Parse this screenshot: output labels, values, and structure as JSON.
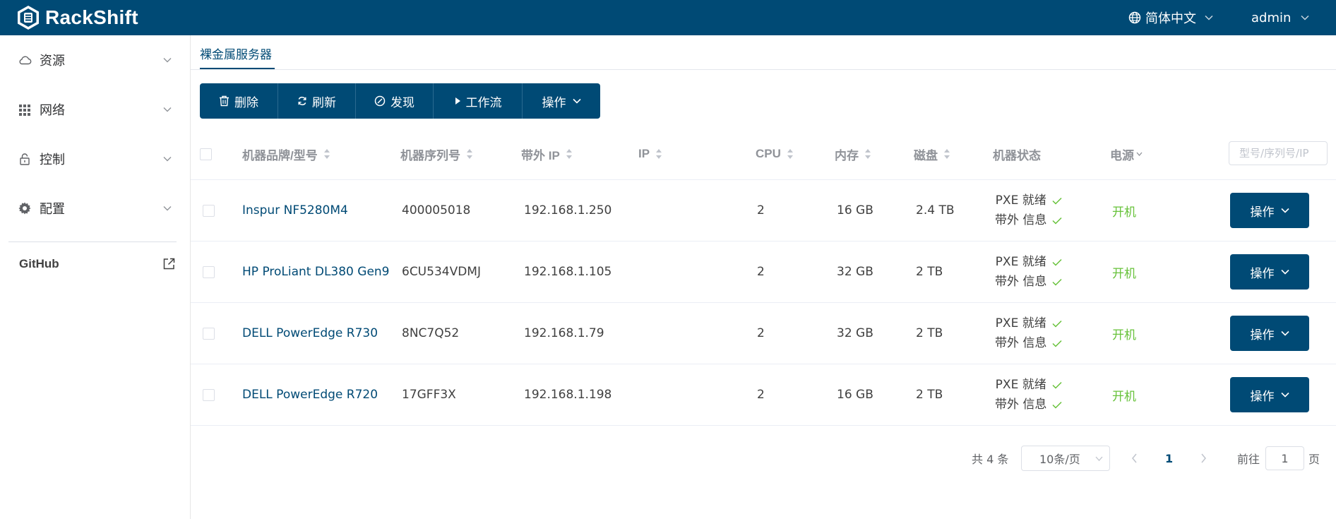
{
  "header": {
    "app_name": "RackShift",
    "language": "简体中文",
    "user": "admin",
    "brand_color": "#004a75"
  },
  "sidebar": {
    "items": [
      {
        "label": "资源",
        "icon": "cloud-icon"
      },
      {
        "label": "网络",
        "icon": "grid-icon"
      },
      {
        "label": "控制",
        "icon": "lock-icon"
      },
      {
        "label": "配置",
        "icon": "gear-icon"
      }
    ],
    "github": "GitHub"
  },
  "tabs": [
    {
      "label": "裸金属服务器",
      "active": true
    }
  ],
  "toolbar": {
    "delete": "删除",
    "refresh": "刷新",
    "discover": "发现",
    "workflow": "工作流",
    "actions": "操作"
  },
  "table": {
    "columns": {
      "model": "机器品牌/型号",
      "serial": "机器序列号",
      "oob_ip": "带外 IP",
      "ip": "IP",
      "cpu": "CPU",
      "memory": "内存",
      "disk": "磁盘",
      "status": "机器状态",
      "power": "电源"
    },
    "search_placeholder": "型号/序列号/IP",
    "rows": [
      {
        "model": "Inspur NF5280M4",
        "serial": "400005018",
        "oob_ip": "192.168.1.250",
        "ip": "",
        "cpu": "2",
        "memory": "16 GB",
        "disk": "2.4 TB",
        "status1": "PXE 就绪",
        "status2": "带外 信息",
        "power": "开机",
        "action": "操作"
      },
      {
        "model": "HP ProLiant DL380 Gen9",
        "serial": "6CU534VDMJ",
        "oob_ip": "192.168.1.105",
        "ip": "",
        "cpu": "2",
        "memory": "32 GB",
        "disk": "2 TB",
        "status1": "PXE 就绪",
        "status2": "带外 信息",
        "power": "开机",
        "action": "操作"
      },
      {
        "model": "DELL PowerEdge R730",
        "serial": "8NC7Q52",
        "oob_ip": "192.168.1.79",
        "ip": "",
        "cpu": "2",
        "memory": "32 GB",
        "disk": "2 TB",
        "status1": "PXE 就绪",
        "status2": "带外 信息",
        "power": "开机",
        "action": "操作"
      },
      {
        "model": "DELL PowerEdge R720",
        "serial": "17GFF3X",
        "oob_ip": "192.168.1.198",
        "ip": "",
        "cpu": "2",
        "memory": "16 GB",
        "disk": "2 TB",
        "status1": "PXE 就绪",
        "status2": "带外 信息",
        "power": "开机",
        "action": "操作"
      }
    ]
  },
  "pagination": {
    "total": "共 4 条",
    "page_size": "10条/页",
    "current_page": "1",
    "goto_label": "前往",
    "goto_value": "1",
    "page_suffix": "页"
  }
}
